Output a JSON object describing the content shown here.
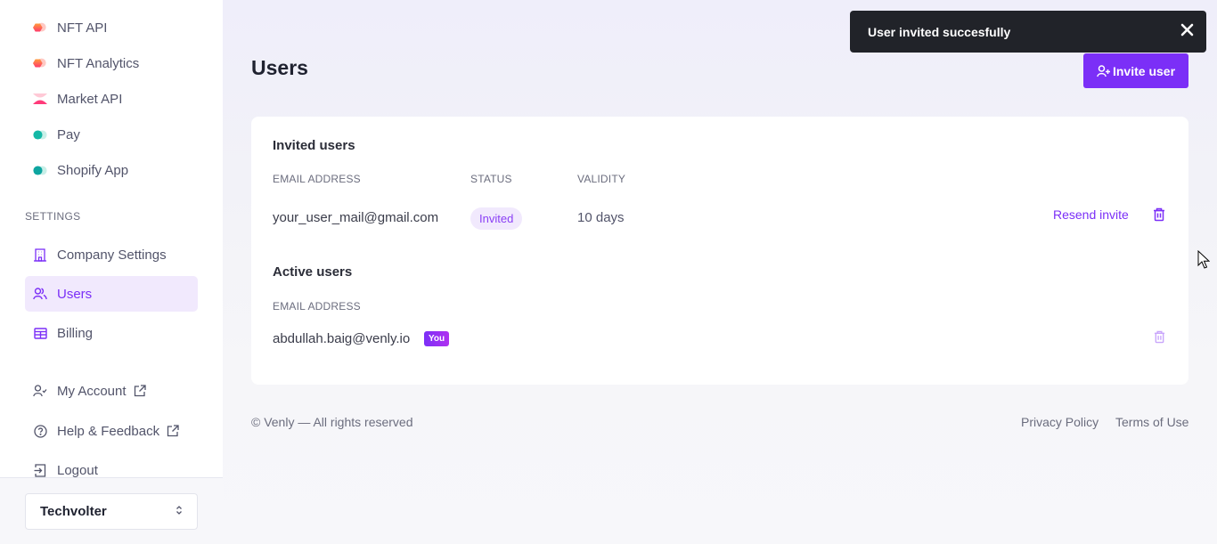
{
  "sidebar": {
    "products": [
      {
        "label": "NFT API",
        "icon": "nft-api-logo-icon"
      },
      {
        "label": "NFT Analytics",
        "icon": "nft-analytics-logo-icon"
      },
      {
        "label": "Market API",
        "icon": "market-api-logo-icon"
      },
      {
        "label": "Pay",
        "icon": "pay-logo-icon"
      },
      {
        "label": "Shopify App",
        "icon": "shopify-app-logo-icon"
      }
    ],
    "settings_label": "SETTINGS",
    "settings": [
      {
        "label": "Company Settings",
        "icon": "building-icon"
      },
      {
        "label": "Users",
        "icon": "users-icon",
        "active": true
      },
      {
        "label": "Billing",
        "icon": "billing-icon"
      }
    ],
    "account": [
      {
        "label": "My Account",
        "icon": "user-check-icon",
        "external": true
      },
      {
        "label": "Help & Feedback",
        "icon": "help-circle-icon",
        "external": true
      },
      {
        "label": "Logout",
        "icon": "logout-icon"
      }
    ],
    "organization": "Techvolter"
  },
  "page": {
    "title": "Users",
    "invite_button": "Invite user"
  },
  "toast": {
    "message": "User invited succesfully"
  },
  "invited": {
    "heading": "Invited users",
    "columns": [
      "EMAIL ADDRESS",
      "STATUS",
      "VALIDITY"
    ],
    "rows": [
      {
        "email": "your_user_mail@gmail.com",
        "status": "Invited",
        "validity": "10 days",
        "action": "Resend invite"
      }
    ]
  },
  "active": {
    "heading": "Active users",
    "columns": [
      "EMAIL ADDRESS"
    ],
    "rows": [
      {
        "email": "abdullah.baig@venly.io",
        "badge": "You"
      }
    ]
  },
  "footer": {
    "copyright": "© Venly — All rights reserved",
    "links": [
      "Privacy Policy",
      "Terms of Use"
    ]
  },
  "colors": {
    "accent": "#7b2ff7",
    "accent_light": "#f1e9fd",
    "toast_bg": "#212329",
    "text_dark": "#1f2230",
    "text_muted": "#6b6d7e"
  }
}
